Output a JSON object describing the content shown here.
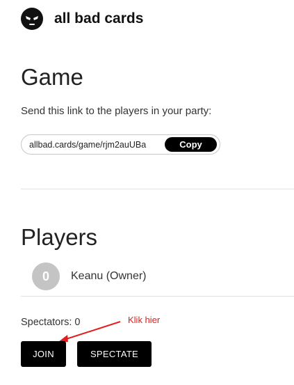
{
  "header": {
    "brand_name": "all bad cards",
    "logo_icon": "evil-face-icon"
  },
  "game": {
    "title": "Game",
    "description": "Send this link to the players in your party:",
    "link": "allbad.cards/game/rjm2auUBa",
    "copy_label": "Copy"
  },
  "players": {
    "title": "Players",
    "list": [
      {
        "avatar_label": "0",
        "name": "Keanu (Owner)"
      }
    ],
    "spectators_text": "Spectators: 0"
  },
  "actions": {
    "join_label": "JOIN",
    "spectate_label": "SPECTATE"
  },
  "annotation": {
    "text": "Klik hier",
    "color": "#e02020"
  }
}
